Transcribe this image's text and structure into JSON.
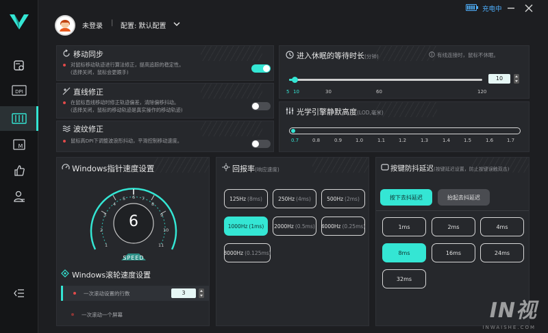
{
  "header": {
    "login_status": "未登录",
    "config_label": "配置: 默认配置",
    "charging_status": "充电中"
  },
  "motion_sync": {
    "title": "移动同步",
    "desc_line1": "对鼠标移动轨迹进行算法修正，提高追踪的稳定性。",
    "desc_line2": "(选择关闭，鼠标会更跟手)",
    "enabled": true
  },
  "angle_snap": {
    "title": "直线修正",
    "desc_line1": "在鼠标直线移动时修正轨迹偏差，清除偏移抖动。",
    "desc_line2": "(选择关闭，鼠标的移动轨迹是真实操作的移动轨迹)",
    "enabled": false
  },
  "ripple": {
    "title": "波纹修正",
    "desc": "鼠标高DPI下调整波浪形抖动，平滑控制移动速度。",
    "enabled": false
  },
  "sleep": {
    "title": "进入休眠的等待时长",
    "unit": "(分钟)",
    "note": "有线连接时，鼠标不休眠。",
    "value": "10",
    "ticks": [
      "5",
      "10",
      "30",
      "60",
      "120"
    ]
  },
  "lod": {
    "title": "光学引擎静默高度",
    "unit": "(LOD,毫米)",
    "ticks": [
      "0.7",
      "0.8",
      "0.9",
      "1.0",
      "1.1",
      "1.2",
      "1.3",
      "1.4",
      "1.5",
      "1.6",
      "1.7"
    ],
    "selected": "0.7"
  },
  "pointer_speed": {
    "title": "Windows指针速度设置",
    "value": "6",
    "label": "SPEED",
    "gauge_ticks": [
      "1",
      "2",
      "3",
      "4",
      "5",
      "6",
      "7",
      "8",
      "9",
      "10",
      "11"
    ]
  },
  "scroll": {
    "title": "Windows滚轮速度设置",
    "option1": "一次滚动设置的行数",
    "option1_value": "3",
    "option2": "一次滚动一个屏幕"
  },
  "polling": {
    "title": "回报率",
    "subtitle": "(响应速度)",
    "options": [
      {
        "hz": "125Hz",
        "ms": "(8ms)"
      },
      {
        "hz": "250Hz",
        "ms": "(4ms)"
      },
      {
        "hz": "500Hz",
        "ms": "(2ms)"
      },
      {
        "hz": "1000Hz",
        "ms": "(1ms)"
      },
      {
        "hz": "2000Hz",
        "ms": "(0.5ms)"
      },
      {
        "hz": "4000Hz",
        "ms": "(0.25ms)"
      },
      {
        "hz": "8000Hz",
        "ms": "(0.125ms)"
      }
    ],
    "selected": "1000Hz"
  },
  "debounce": {
    "title": "按键防抖延迟",
    "subtitle": "(按键延迟设置，防止按键误触双击)",
    "press_label": "按下去抖延迟",
    "release_label": "抬起去抖延迟",
    "options": [
      "1ms",
      "2ms",
      "4ms",
      "8ms",
      "16ms",
      "24ms",
      "32ms"
    ],
    "selected": "8ms"
  },
  "watermark": {
    "brand": "IN视",
    "site": "INWAISHE.COM"
  },
  "colors": {
    "accent": "#34e6d4",
    "background": "#1d1e21",
    "panel": "#26282c"
  }
}
